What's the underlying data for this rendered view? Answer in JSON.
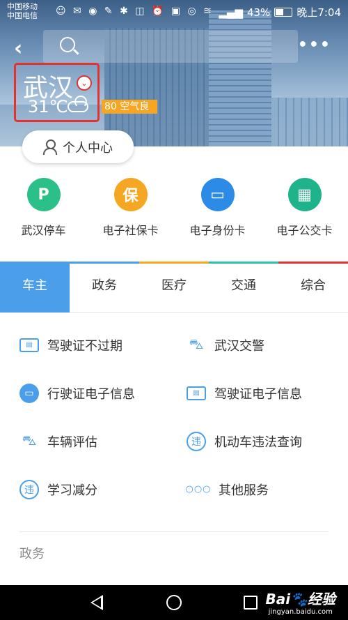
{
  "status_bar": {
    "carrier1": "中国移动",
    "carrier2": "中国电信",
    "battery": "43%",
    "battery_level": 0.43,
    "time": "晚上7:04"
  },
  "header": {
    "city": "武汉",
    "temperature": "31℃",
    "aqi": "80 空气良",
    "profile_label": "个人中心",
    "highlight_color": "#e3322f"
  },
  "quick_services": [
    {
      "label": "武汉停车",
      "icon": "parking-icon",
      "glyph": "P",
      "color": "#2bbf8a"
    },
    {
      "label": "电子社保卡",
      "icon": "social-security-card-icon",
      "glyph": "保",
      "color": "#f5a623"
    },
    {
      "label": "电子身份卡",
      "icon": "id-card-icon",
      "glyph": "▭",
      "color": "#2b8be6"
    },
    {
      "label": "电子公交卡",
      "icon": "bus-card-icon",
      "glyph": "▦",
      "color": "#1fb38b"
    }
  ],
  "tabs": [
    {
      "label": "车主",
      "active": true,
      "color": "#4a9eea"
    },
    {
      "label": "政务",
      "active": false,
      "color": "#4a9eea"
    },
    {
      "label": "医疗",
      "active": false,
      "color": "#f5a623"
    },
    {
      "label": "交通",
      "active": false,
      "color": "#2bbfae"
    },
    {
      "label": "综合",
      "active": false,
      "color": "#e3322f"
    }
  ],
  "services": [
    {
      "label": "驾驶证不过期",
      "icon": "license-card-icon"
    },
    {
      "label": "武汉交警",
      "icon": "car-icon"
    },
    {
      "label": "行驶证电子信息",
      "icon": "vehicle-license-icon"
    },
    {
      "label": "驾驶证电子信息",
      "icon": "license-card-icon"
    },
    {
      "label": "车辆评估",
      "icon": "car-icon"
    },
    {
      "label": "机动车违法查询",
      "icon": "violation-search-icon"
    },
    {
      "label": "学习减分",
      "icon": "violation-search-icon"
    },
    {
      "label": "其他服务",
      "icon": "more-dots-icon"
    }
  ],
  "section_label": "政务",
  "watermark": {
    "brand": "Bai🐾经验",
    "site": "jingyan.baidu.com"
  }
}
